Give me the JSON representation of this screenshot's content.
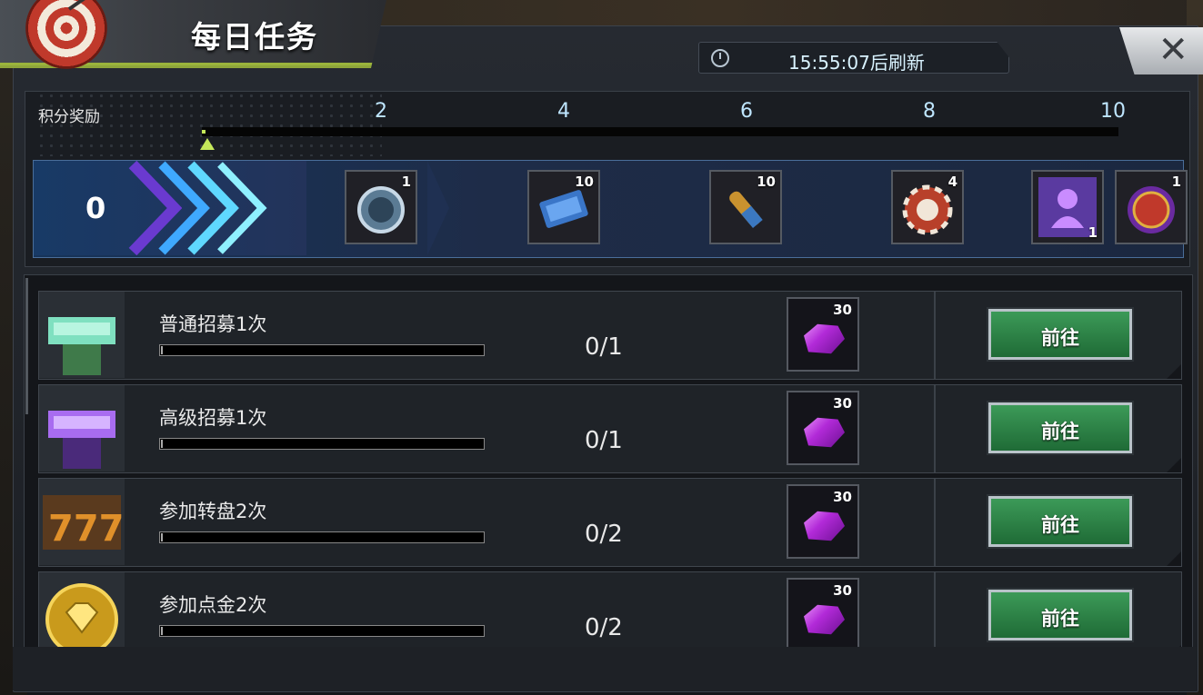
{
  "header": {
    "title": "每日任务",
    "refresh_timer": "15:55:07后刷新",
    "close_label": "✕"
  },
  "points_rewards": {
    "label": "积分奖励",
    "current_points": "0",
    "points_progress": 0,
    "milestones": [
      "2",
      "4",
      "6",
      "8",
      "10"
    ],
    "rewards": [
      {
        "icon": "stopwatch-coin-icon",
        "count": "1"
      },
      {
        "icon": "cinema-ticket-icon",
        "count": "10"
      },
      {
        "icon": "bullet-icon",
        "count": "10"
      },
      {
        "icon": "casino-chip-icon",
        "count": "4"
      },
      {
        "icon": "purple-silhouette-card-icon",
        "count": "1"
      },
      {
        "icon": "red-medal-icon",
        "count": "1"
      }
    ]
  },
  "tasks": [
    {
      "name": "普通招募1次",
      "progress": "0/1",
      "progress_fraction": 0,
      "reward_icon": "purple-gem-icon",
      "reward_count": "30",
      "button_label": "前往",
      "icon": "green-recruit-tower-icon"
    },
    {
      "name": "高级招募1次",
      "progress": "0/1",
      "progress_fraction": 0,
      "reward_icon": "purple-gem-icon",
      "reward_count": "30",
      "button_label": "前往",
      "icon": "purple-recruit-tower-icon"
    },
    {
      "name": "参加转盘2次",
      "progress": "0/2",
      "progress_fraction": 0,
      "reward_icon": "purple-gem-icon",
      "reward_count": "30",
      "button_label": "前往",
      "icon": "slot-777-icon"
    },
    {
      "name": "参加点金2次",
      "progress": "0/2",
      "progress_fraction": 0,
      "reward_icon": "purple-gem-icon",
      "reward_count": "30",
      "button_label": "前往",
      "icon": "gold-diamond-coin-icon"
    }
  ],
  "colors": {
    "accent_green": "#2f8a4a",
    "marker_green": "#c5e85a",
    "gem_purple": "#b22ad8",
    "ribbon_blue": "#1e2c48"
  }
}
